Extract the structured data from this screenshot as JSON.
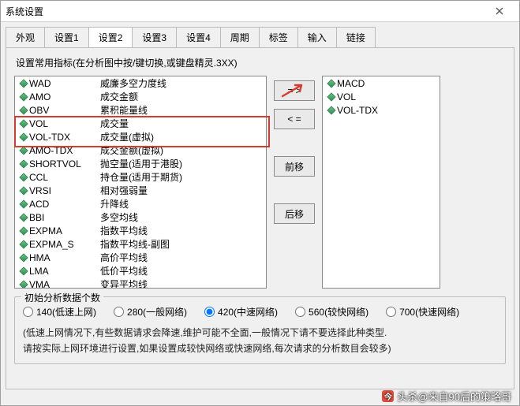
{
  "window": {
    "title": "系统设置"
  },
  "tabs": [
    "外观",
    "设置1",
    "设置2",
    "设置3",
    "设置4",
    "周期",
    "标签",
    "输入",
    "链接"
  ],
  "active_tab_index": 2,
  "hint": "设置常用指标(在分析图中按/键切换,或键盘精灵.3XX)",
  "left_list": [
    {
      "code": "WAD",
      "desc": "威廉多空力度线"
    },
    {
      "code": "AMO",
      "desc": "成交金额"
    },
    {
      "code": "OBV",
      "desc": "累积能量线"
    },
    {
      "code": "VOL",
      "desc": "成交量"
    },
    {
      "code": "VOL-TDX",
      "desc": "成交量(虚拟)"
    },
    {
      "code": "AMO-TDX",
      "desc": "成交金额(虚拟)"
    },
    {
      "code": "SHORTVOL",
      "desc": "抛空量(适用于港股)"
    },
    {
      "code": "CCL",
      "desc": "持仓量(适用于期货)"
    },
    {
      "code": "VRSI",
      "desc": "相对强弱量"
    },
    {
      "code": "ACD",
      "desc": "升降线"
    },
    {
      "code": "BBI",
      "desc": "多空均线"
    },
    {
      "code": "EXPMA",
      "desc": "指数平均线"
    },
    {
      "code": "EXPMA_S",
      "desc": "指数平均线-副图"
    },
    {
      "code": "HMA",
      "desc": "高价平均线"
    },
    {
      "code": "LMA",
      "desc": "低价平均线"
    },
    {
      "code": "VMA",
      "desc": "变异平均线"
    }
  ],
  "right_list": [
    {
      "code": "MACD"
    },
    {
      "code": "VOL"
    },
    {
      "code": "VOL-TDX"
    }
  ],
  "highlight_left": {
    "from": 3,
    "to": 4
  },
  "buttons": {
    "add": "= >",
    "remove": "< =",
    "up": "前移",
    "down": "后移"
  },
  "group": {
    "legend": "初始分析数据个数",
    "options": [
      {
        "label": "140(低速上网)",
        "value": 140
      },
      {
        "label": "280(一般网络)",
        "value": 280
      },
      {
        "label": "420(中速网络)",
        "value": 420
      },
      {
        "label": "560(较快网络)",
        "value": 560
      },
      {
        "label": "700(快速网络)",
        "value": 700
      }
    ],
    "selected": 420,
    "note_line1": "(低速上网情况下,有些数据请求会降速,维护可能不全面,一般情况下请不要选择此种类型.",
    "note_line2": "请按实际上网环境进行设置,如果设置成较快网络或快速网络,每次请求的分析数目会较多)"
  },
  "watermark": "头杀@来自90后的策略哥"
}
